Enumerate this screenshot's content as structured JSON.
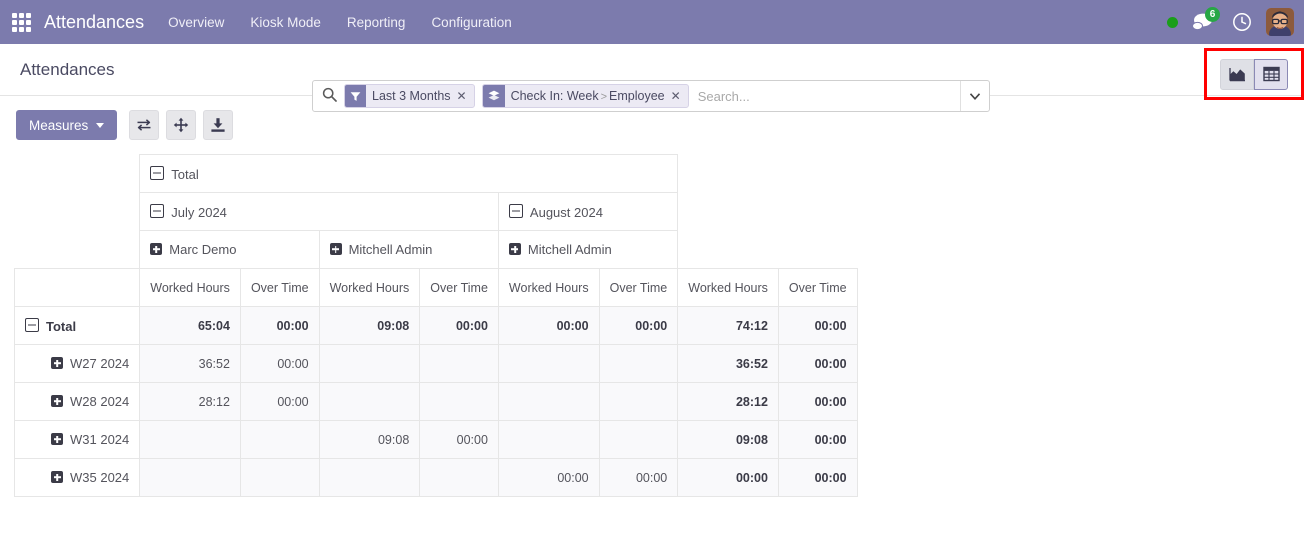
{
  "navbar": {
    "apps_icon": "apps-grid-icon",
    "brand": "Attendances",
    "menu": [
      {
        "label": "Overview",
        "name": "overview"
      },
      {
        "label": "Kiosk Mode",
        "name": "kiosk-mode"
      },
      {
        "label": "Reporting",
        "name": "reporting"
      },
      {
        "label": "Configuration",
        "name": "configuration"
      }
    ],
    "systray": {
      "presence_status": "online",
      "messages_count": "6",
      "clock_icon": "clock-icon",
      "avatar_alt": "user-avatar"
    }
  },
  "control_panel": {
    "title": "Attendances",
    "search": {
      "placeholder": "Search...",
      "value": "",
      "facets": [
        {
          "icon": "filter-icon",
          "label": "Last 3 Months",
          "type": "filter"
        },
        {
          "icon": "groupby-icon",
          "label": "Check In: Week",
          "separator": ">",
          "label2": "Employee",
          "type": "groupby"
        }
      ]
    },
    "views": [
      {
        "name": "graph-view",
        "icon": "graph-icon",
        "active": false
      },
      {
        "name": "pivot-view",
        "icon": "pivot-icon",
        "active": true
      }
    ],
    "highlight_color": "#ff0000"
  },
  "pivot_toolbar": {
    "measures_label": "Measures",
    "buttons": [
      {
        "name": "flip-axis-button",
        "icon": "flip-axis-icon"
      },
      {
        "name": "expand-all-button",
        "icon": "expand-all-icon"
      },
      {
        "name": "download-xlsx-button",
        "icon": "download-icon"
      }
    ]
  },
  "theme": {
    "primary": "#7c7bad",
    "navbar_bg": "#7c7bad",
    "cell_bg": "#f9f9fb",
    "badge_green": "#28a745"
  },
  "chart_data": {
    "type": "table",
    "title": "Attendances Pivot",
    "grand_total_label": "Total",
    "col_group_total": "Total",
    "col_groups": [
      {
        "label": "July 2024",
        "employees": [
          {
            "label": "Marc Demo",
            "measures": [
              "Worked Hours",
              "Over Time"
            ]
          },
          {
            "label": "Mitchell Admin",
            "measures": [
              "Worked Hours",
              "Over Time"
            ]
          }
        ]
      },
      {
        "label": "August 2024",
        "employees": [
          {
            "label": "Mitchell Admin",
            "measures": [
              "Worked Hours",
              "Over Time"
            ]
          }
        ]
      }
    ],
    "total_measures": [
      "Worked Hours",
      "Over Time"
    ],
    "measure_names": [
      "Worked Hours",
      "Over Time"
    ],
    "row_headers": [
      {
        "label": "Total",
        "toggle": "minus",
        "level": 0
      },
      {
        "label": "W27 2024",
        "toggle": "plus",
        "level": 1
      },
      {
        "label": "W28 2024",
        "toggle": "plus",
        "level": 1
      },
      {
        "label": "W31 2024",
        "toggle": "plus",
        "level": 1
      },
      {
        "label": "W35 2024",
        "toggle": "plus",
        "level": 1
      }
    ],
    "columns": [
      "July 2024 / Marc Demo / Worked Hours",
      "July 2024 / Marc Demo / Over Time",
      "July 2024 / Mitchell Admin / Worked Hours",
      "July 2024 / Mitchell Admin / Over Time",
      "August 2024 / Mitchell Admin / Worked Hours",
      "August 2024 / Mitchell Admin / Over Time",
      "Total / Worked Hours",
      "Total / Over Time"
    ],
    "rows": [
      {
        "header": "Total",
        "values": [
          "65:04",
          "00:00",
          "09:08",
          "00:00",
          "00:00",
          "00:00",
          "74:12",
          "00:00"
        ]
      },
      {
        "header": "W27 2024",
        "values": [
          "36:52",
          "00:00",
          "",
          "",
          "",
          "",
          "36:52",
          "00:00"
        ]
      },
      {
        "header": "W28 2024",
        "values": [
          "28:12",
          "00:00",
          "",
          "",
          "",
          "",
          "28:12",
          "00:00"
        ]
      },
      {
        "header": "W31 2024",
        "values": [
          "",
          "",
          "09:08",
          "00:00",
          "",
          "",
          "09:08",
          "00:00"
        ]
      },
      {
        "header": "W35 2024",
        "values": [
          "",
          "",
          "",
          "",
          "00:00",
          "00:00",
          "00:00",
          "00:00"
        ]
      }
    ]
  }
}
